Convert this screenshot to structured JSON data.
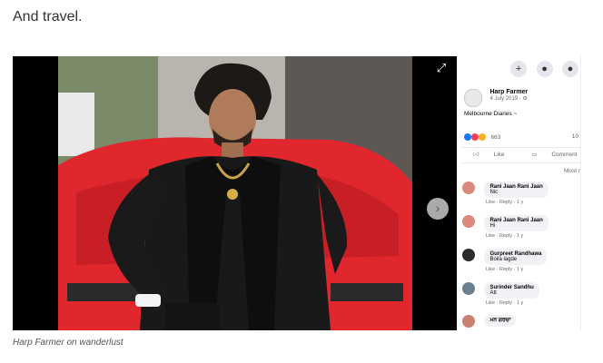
{
  "article": {
    "intro_text": "And travel.",
    "caption": "Harp Farmer on wanderlust"
  },
  "viewer": {
    "expand_icon": "expand-icon",
    "next_icon": "chevron-right-icon"
  },
  "facebook": {
    "top_icons": [
      "+",
      "●",
      "●"
    ],
    "author_name": "Harp Farmer",
    "post_date": "4 July 2019 · ⚙",
    "post_text": "Melbourne Diaries ~",
    "reaction_count": "663",
    "share_count": "10",
    "like_label": "Like",
    "comment_label": "Comment",
    "sort_label": "Most r",
    "comments": [
      {
        "name": "Rani Jaan Rani Jaan",
        "text": "Nic",
        "meta": "Like · Reply · 1 y"
      },
      {
        "name": "Rani Jaan Rani Jaan",
        "text": "Hi",
        "meta": "Like · Reply · 1 y"
      },
      {
        "name": "Gurpreet Randhawa",
        "text": "Boila lagde",
        "meta": "Like · Reply · 1 y"
      },
      {
        "name": "Surinder Sandhu",
        "text": "Att",
        "meta": "Like · Reply · 1 y"
      },
      {
        "name": "ਮਨ ਗਰਚਾ",
        "text": "",
        "meta": ""
      }
    ],
    "colors": {
      "like_blue": "#1877f2",
      "love_red": "#f33e58",
      "haha_yellow": "#f7b125"
    }
  }
}
